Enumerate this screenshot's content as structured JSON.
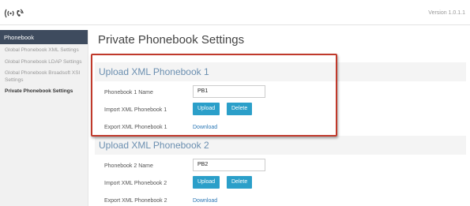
{
  "header": {
    "logo_icon": "grandstream-wave-logo",
    "version": "Version 1.0.1.1"
  },
  "sidebar": {
    "title": "Phonebook",
    "items": [
      {
        "label": "Global Phonebook XML Settings",
        "active": false
      },
      {
        "label": "Global Phonebook LDAP Settings",
        "active": false
      },
      {
        "label": "Global Phonebook Broadsoft XSI Settings",
        "active": false
      },
      {
        "label": "Private Phonebook Settings",
        "active": true
      }
    ]
  },
  "page": {
    "title": "Private Phonebook Settings"
  },
  "sections": [
    {
      "title": "Upload XML Phonebook 1",
      "name_label": "Phonebook 1 Name",
      "name_value": "PB1",
      "import_label": "Import XML Phonebook 1",
      "upload_label": "Upload",
      "delete_label": "Delete",
      "export_label": "Export XML Phonebook 1",
      "download_label": "Download"
    },
    {
      "title": "Upload XML Phonebook 2",
      "name_label": "Phonebook 2 Name",
      "name_value": "PB2",
      "import_label": "Import XML Phonebook 2",
      "upload_label": "Upload",
      "delete_label": "Delete",
      "export_label": "Export XML Phonebook 2",
      "download_label": "Download"
    }
  ],
  "colors": {
    "accent_button": "#2b9fc9",
    "sidebar_header": "#3e4b5e",
    "highlight_border": "#c0392b",
    "section_title": "#6b8fb0"
  }
}
